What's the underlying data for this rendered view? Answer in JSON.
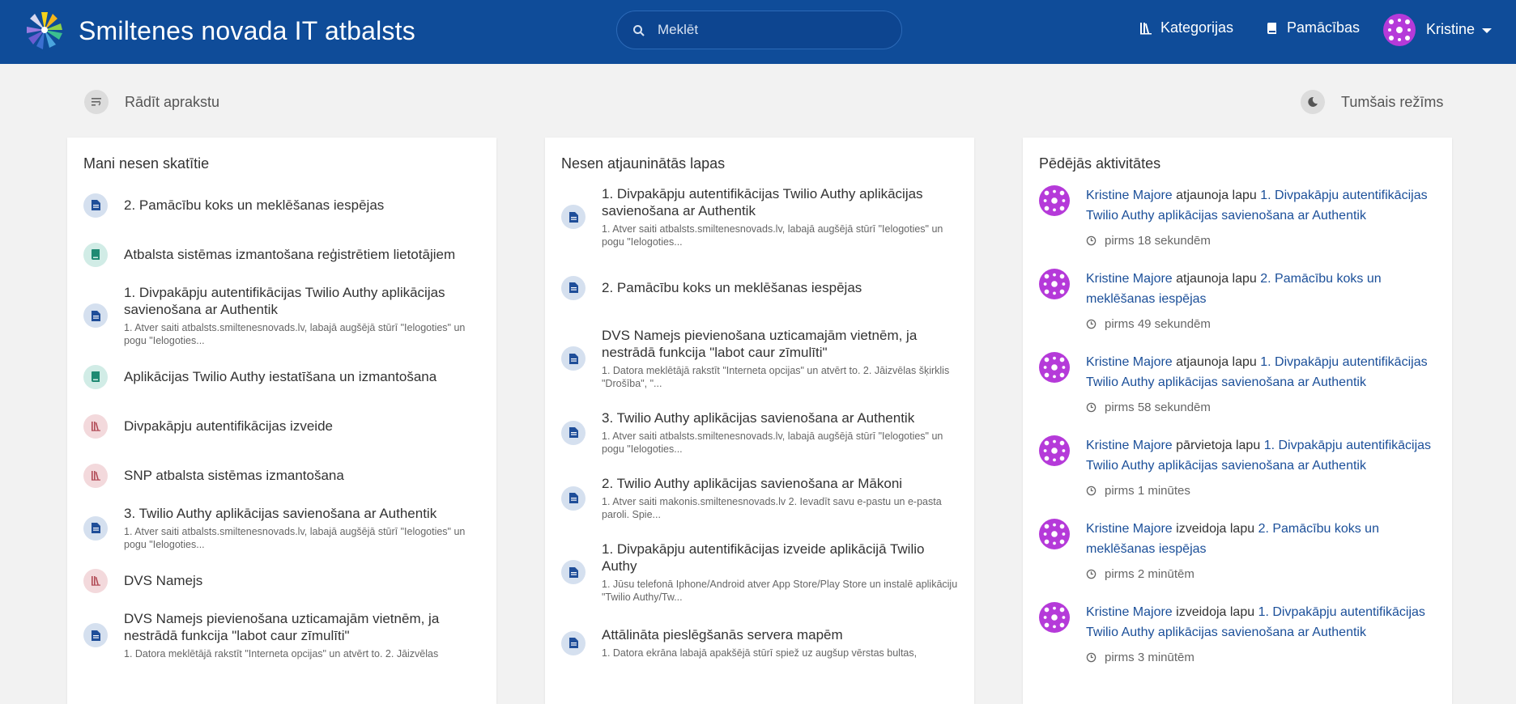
{
  "header": {
    "site_title": "Smiltenes novada IT atbalsts",
    "search_placeholder": "Meklēt",
    "nav": {
      "categories": "Kategorijas",
      "guides": "Pamācības"
    },
    "user_name": "Kristine"
  },
  "toolbar": {
    "show_description": "Rādīt aprakstu",
    "dark_mode": "Tumšais režīms"
  },
  "recently_viewed": {
    "title": "Mani nesen skatītie",
    "items": [
      {
        "type": "page",
        "name": "2. Pamācību koks un meklēšanas iespējas",
        "excerpt": ""
      },
      {
        "type": "book",
        "name": "Atbalsta sistēmas izmantošana reģistrētiem lietotājiem",
        "excerpt": ""
      },
      {
        "type": "page",
        "name": "1. Divpakāpju autentifikācijas Twilio Authy aplikācijas savienošana ar Authentik",
        "excerpt": "1. Atver saiti atbalsts.smiltenesnovads.lv, labajā augšējā stūrī \"Ielogoties\" un pogu \"Ielogoties..."
      },
      {
        "type": "book",
        "name": "Aplikācijas Twilio Authy iestatīšana un izmantošana",
        "excerpt": ""
      },
      {
        "type": "shelf",
        "name": "Divpakāpju autentifikācijas izveide",
        "excerpt": ""
      },
      {
        "type": "shelf",
        "name": "SNP atbalsta sistēmas izmantošana",
        "excerpt": ""
      },
      {
        "type": "page",
        "name": "3. Twilio Authy aplikācijas savienošana ar Authentik",
        "excerpt": "1. Atver saiti atbalsts.smiltenesnovads.lv, labajā augšējā stūrī \"Ielogoties\" un pogu \"Ielogoties..."
      },
      {
        "type": "shelf",
        "name": "DVS Namejs",
        "excerpt": ""
      },
      {
        "type": "page",
        "name": "DVS Namejs pievienošana uzticamajām vietnēm, ja nestrādā funkcija \"labot caur zīmulīti\"",
        "excerpt": "1. Datora meklētājā rakstīt \"Interneta opcijas\" un atvērt to. 2. Jāizvēlas"
      }
    ]
  },
  "recently_updated": {
    "title": "Nesen atjauninātās lapas",
    "items": [
      {
        "name": "1. Divpakāpju autentifikācijas Twilio Authy aplikācijas savienošana ar Authentik",
        "excerpt": "1. Atver saiti atbalsts.smiltenesnovads.lv, labajā augšējā stūrī \"Ielogoties\" un pogu \"Ielogoties..."
      },
      {
        "name": "2. Pamācību koks un meklēšanas iespējas",
        "excerpt": ""
      },
      {
        "name": "DVS Namejs pievienošana uzticamajām vietnēm, ja nestrādā funkcija \"labot caur zīmulīti\"",
        "excerpt": "1. Datora meklētājā rakstīt \"Interneta opcijas\" un atvērt to. 2. Jāizvēlas šķirklis \"Drošība\", \"..."
      },
      {
        "name": "3. Twilio Authy aplikācijas savienošana ar Authentik",
        "excerpt": "1. Atver saiti atbalsts.smiltenesnovads.lv, labajā augšējā stūrī \"Ielogoties\" un pogu \"Ielogoties..."
      },
      {
        "name": "2. Twilio Authy aplikācijas savienošana ar Mākoni",
        "excerpt": "1. Atver saiti makonis.smiltenesnovads.lv 2. Ievadīt savu e-pastu un e-pasta paroli. Spie..."
      },
      {
        "name": "1. Divpakāpju autentifikācijas izveide aplikācijā Twilio Authy",
        "excerpt": "1. Jūsu telefonā Iphone/Android atver App Store/Play Store un instalē aplikāciju \"Twilio Authy/Tw..."
      },
      {
        "name": "Attālināta pieslēgšanās servera mapēm",
        "excerpt": "1. Datora ekrāna labajā apakšējā stūrī spiež uz augšup vērstas bultas,"
      }
    ]
  },
  "activity": {
    "title": "Pēdējās aktivitātes",
    "items": [
      {
        "user": "Kristine Majore",
        "action": "atjaunoja lapu",
        "target": "1. Divpakāpju autentifikācijas Twilio Authy aplikācijas savienošana ar Authentik",
        "time": "pirms 18 sekundēm"
      },
      {
        "user": "Kristine Majore",
        "action": "atjaunoja lapu",
        "target": "2. Pamācību koks un meklēšanas iespējas",
        "time": "pirms 49 sekundēm"
      },
      {
        "user": "Kristine Majore",
        "action": "atjaunoja lapu",
        "target": "1. Divpakāpju autentifikācijas Twilio Authy aplikācijas savienošana ar Authentik",
        "time": "pirms 58 sekundēm"
      },
      {
        "user": "Kristine Majore",
        "action": "pārvietoja lapu",
        "target": "1. Divpakāpju autentifikācijas Twilio Authy aplikācijas savienošana ar Authentik",
        "time": "pirms 1 minūtes"
      },
      {
        "user": "Kristine Majore",
        "action": "izveidoja lapu",
        "target": "2. Pamācību koks un meklēšanas iespējas",
        "time": "pirms 2 minūtēm"
      },
      {
        "user": "Kristine Majore",
        "action": "izveidoja lapu",
        "target": "1. Divpakāpju autentifikācijas Twilio Authy aplikācijas savienošana ar Authentik",
        "time": "pirms 3 minūtēm"
      }
    ]
  },
  "colors": {
    "header_bg": "#0f4c99",
    "link": "#1b4f99",
    "page_icon": "#1f4e99",
    "book_icon": "#1f8a73",
    "shelf_icon": "#b14a55"
  }
}
